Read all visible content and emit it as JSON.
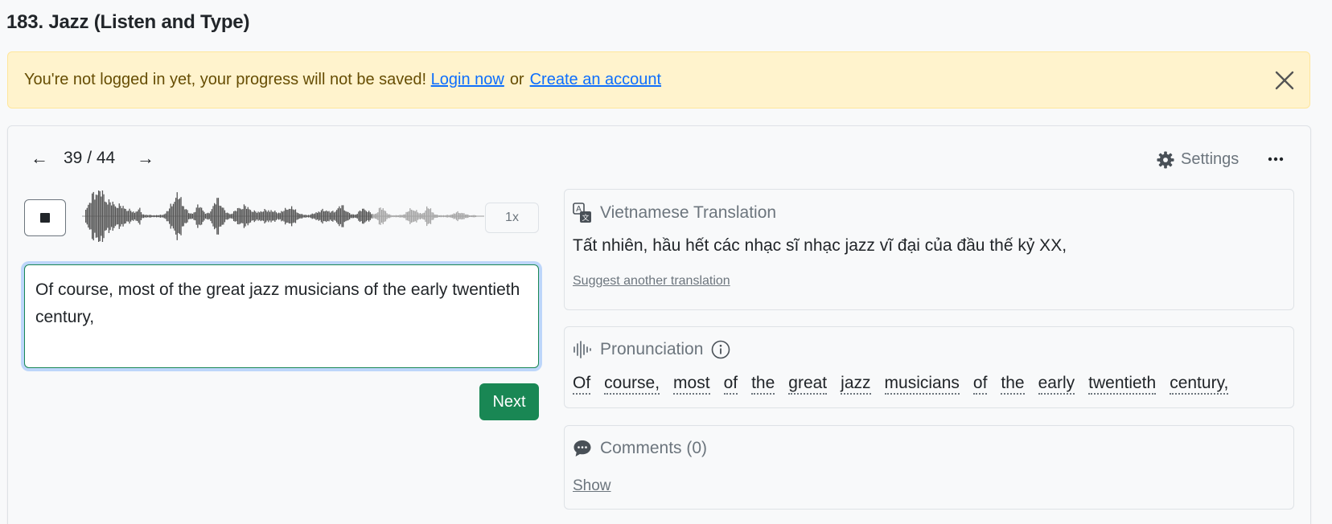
{
  "page": {
    "title": "183. Jazz (Listen and Type)"
  },
  "alert": {
    "message": "You're not logged in yet, your progress will not be saved!",
    "login_label": "Login now",
    "separator": "or",
    "create_label": "Create an account"
  },
  "navigation": {
    "prev_glyph": "←",
    "counter": "39 / 44",
    "next_glyph": "→"
  },
  "toolbar": {
    "settings_label": "Settings"
  },
  "player": {
    "speed_label": "1x",
    "progress_fraction": 0.72,
    "played_color": "#555555",
    "unplayed_color": "#a6a6a6"
  },
  "answer": {
    "value": "Of course, most of the great jazz musicians of the early twentieth century,"
  },
  "actions": {
    "next_label": "Next"
  },
  "translation": {
    "heading": "Vietnamese Translation",
    "text": "Tất nhiên, hầu hết các nhạc sĩ nhạc jazz vĩ đại của đầu thế kỷ XX,",
    "suggest_label": "Suggest another translation"
  },
  "pronunciation": {
    "heading": "Pronunciation",
    "words": [
      "Of",
      "course,",
      "most",
      "of",
      "the",
      "great",
      "jazz",
      "musicians",
      "of",
      "the",
      "early",
      "twentieth",
      "century,"
    ]
  },
  "comments": {
    "heading": "Comments (0)",
    "show_label": "Show"
  },
  "colors": {
    "alert_bg": "#fff3cd",
    "link": "#0d6efd",
    "primary_success": "#198754"
  }
}
